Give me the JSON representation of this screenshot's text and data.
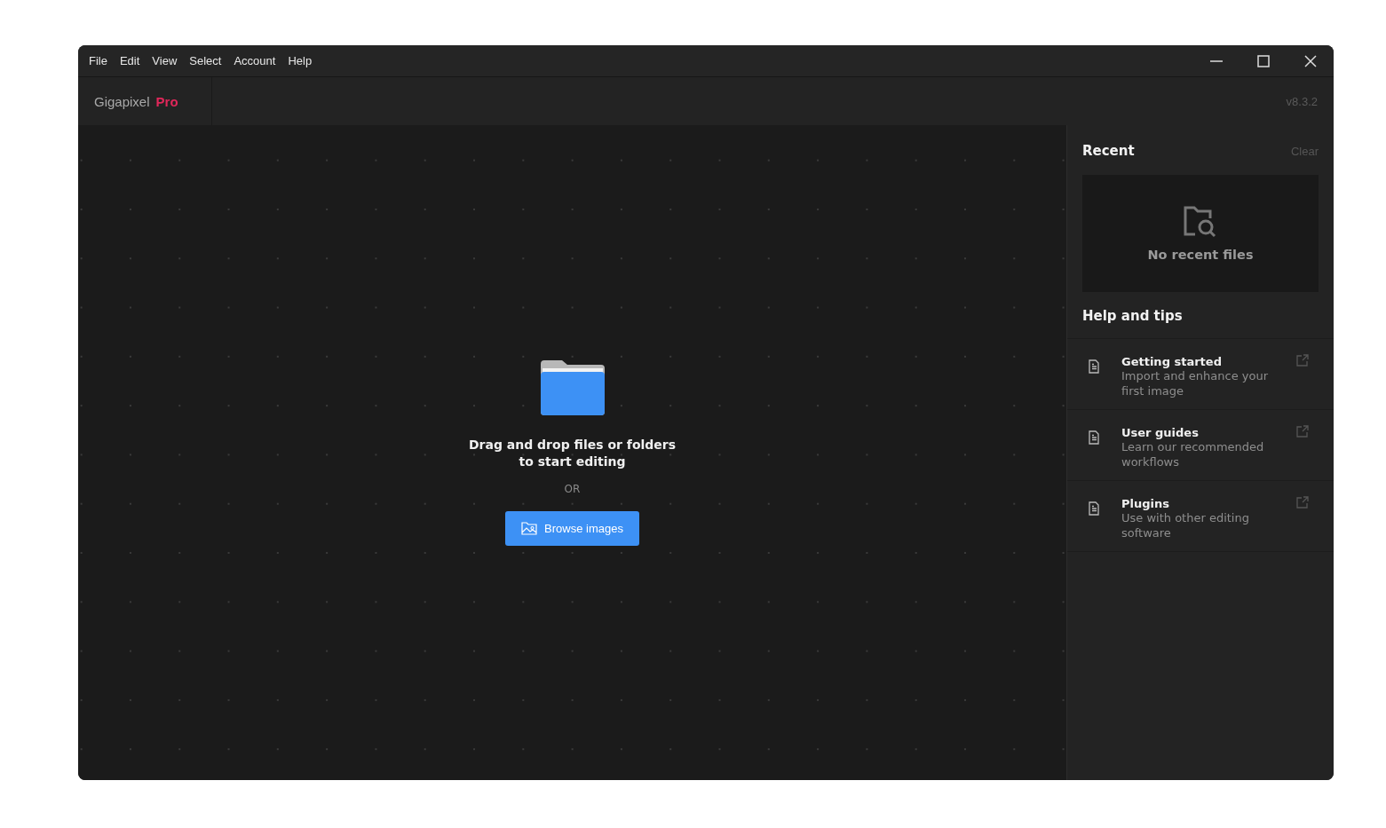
{
  "menu": [
    "File",
    "Edit",
    "View",
    "Select",
    "Account",
    "Help"
  ],
  "brand": {
    "name": "Gigapixel",
    "edition": "Pro"
  },
  "version": "v8.3.2",
  "drop_zone": {
    "message": "Drag and drop files or folders\nto start editing",
    "separator": "OR",
    "button": "Browse images"
  },
  "recent": {
    "title": "Recent",
    "clear": "Clear",
    "empty": "No recent files"
  },
  "help": {
    "title": "Help and tips",
    "items": [
      {
        "title": "Getting started",
        "description": "Import and enhance your first image"
      },
      {
        "title": "User guides",
        "description": "Learn our recommended workflows"
      },
      {
        "title": "Plugins",
        "description": "Use with other editing software"
      }
    ]
  }
}
